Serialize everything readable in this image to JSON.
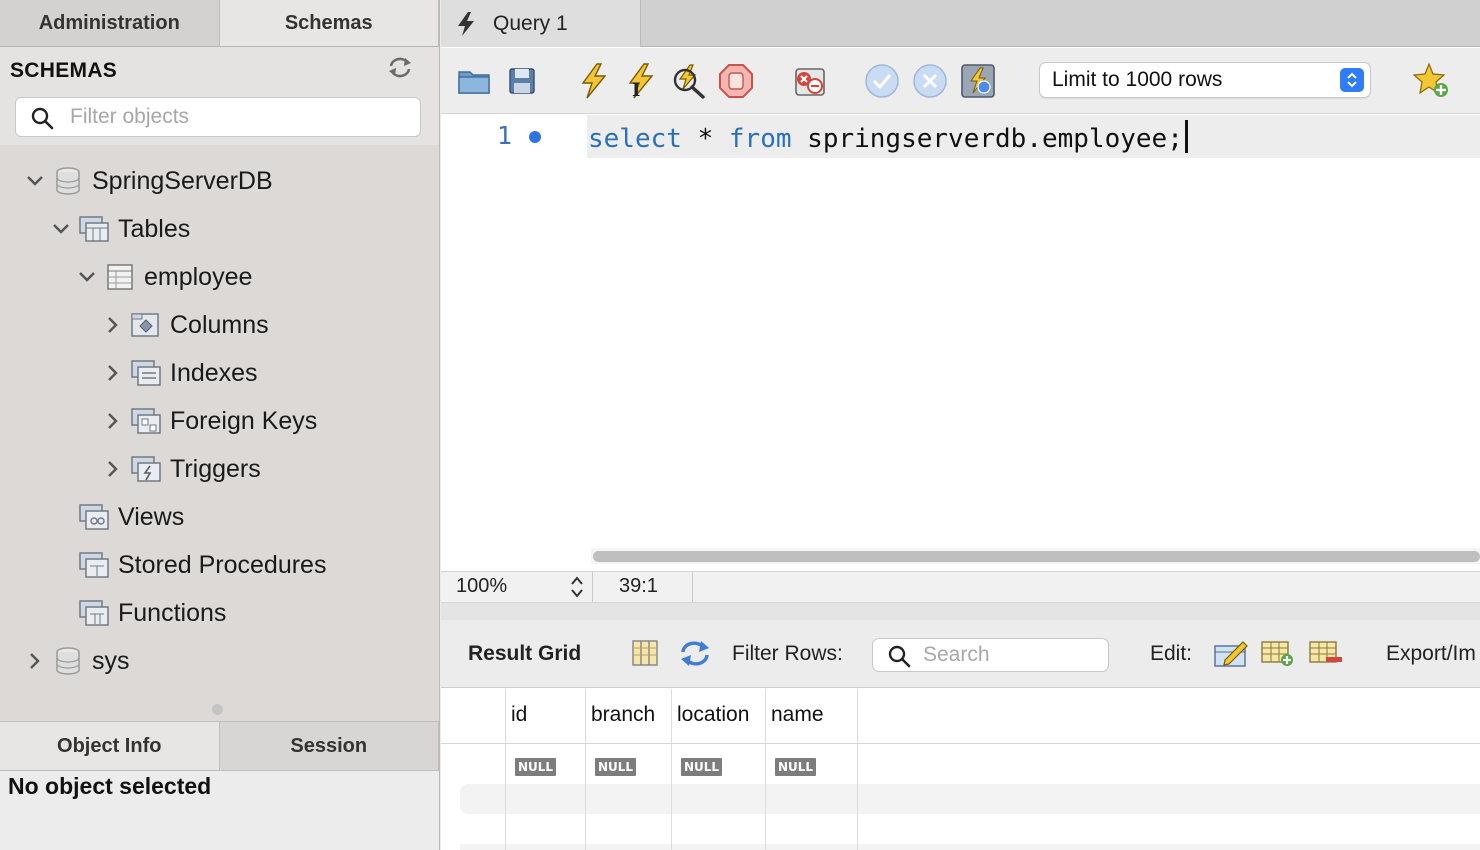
{
  "left_panel": {
    "tabs": [
      "Administration",
      "Schemas"
    ],
    "active_tab": "Schemas",
    "schemas_title": "SCHEMAS",
    "filter_placeholder": "Filter objects",
    "tree": {
      "db1": "SpringServerDB",
      "tables": "Tables",
      "table": "employee",
      "columns": "Columns",
      "indexes": "Indexes",
      "foreign_keys": "Foreign Keys",
      "triggers": "Triggers",
      "views": "Views",
      "stored_procedures": "Stored Procedures",
      "functions": "Functions",
      "db2": "sys"
    },
    "bottom_tabs": [
      "Object Info",
      "Session"
    ],
    "object_info_text": "No object selected"
  },
  "query_tab": {
    "label": "Query 1"
  },
  "toolbar": {
    "limit_select": "Limit to 1000 rows"
  },
  "editor": {
    "line_number": "1",
    "code": {
      "kw1": "select",
      "op": " * ",
      "kw2": "from",
      "rest": " springserverdb.employee;"
    }
  },
  "status": {
    "zoom": "100%",
    "cursor_pos": "39:1"
  },
  "result": {
    "grid_label": "Result Grid",
    "filter_label": "Filter Rows:",
    "search_placeholder": "Search",
    "edit_label": "Edit:",
    "export_label": "Export/Im",
    "columns": [
      "id",
      "branch",
      "location",
      "name"
    ],
    "null_text": "NULL"
  },
  "colors": {
    "keyword": "#2a6fba",
    "accent_blue": "#2f7cf6"
  }
}
